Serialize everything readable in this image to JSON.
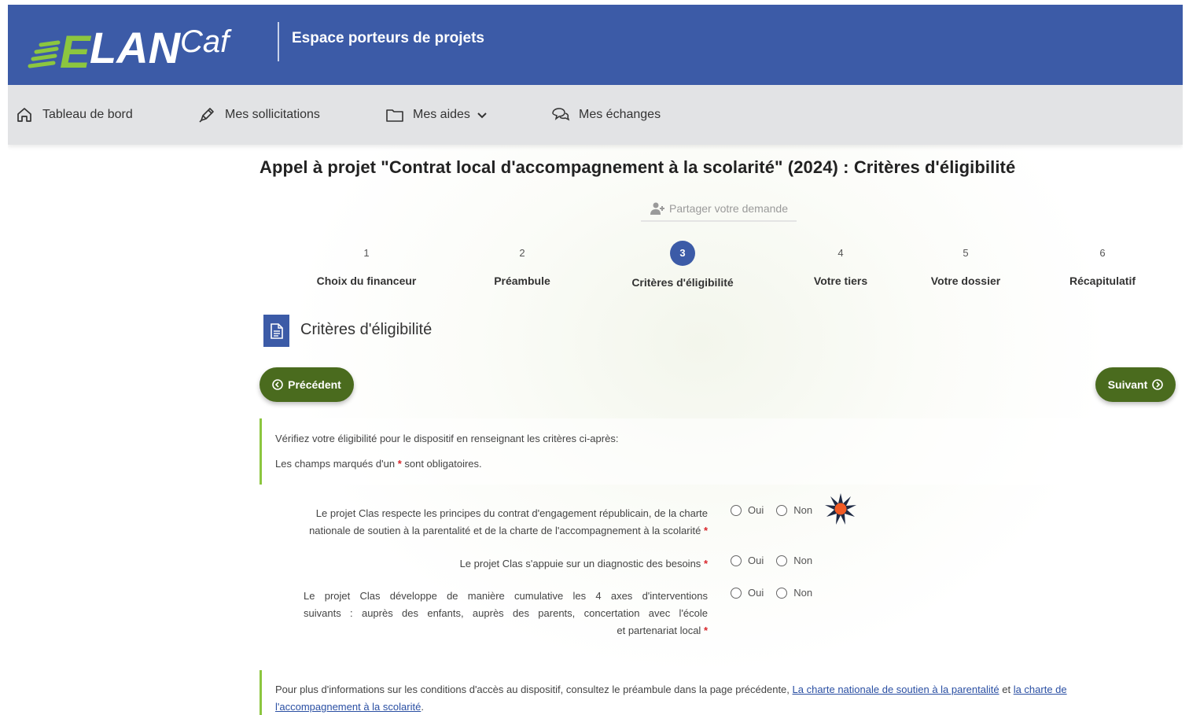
{
  "header": {
    "logo_main": "ELAN",
    "logo_sub": "Caf",
    "title": "Espace porteurs de projets",
    "colors": {
      "brand_blue": "#3c5ba7",
      "logo_green": "#8cc63f"
    }
  },
  "nav": {
    "items": [
      {
        "label": "Tableau de bord",
        "icon": "home-icon"
      },
      {
        "label": "Mes sollicitations",
        "icon": "pen-icon"
      },
      {
        "label": "Mes aides",
        "icon": "folder-icon",
        "has_dropdown": true
      },
      {
        "label": "Mes échanges",
        "icon": "chat-icon"
      }
    ]
  },
  "page": {
    "title": "Appel à projet \"Contrat local d'accompagnement à la scolarité\" (2024) : Critères d'éligibilité",
    "share_label": "Partager votre demande"
  },
  "steps": [
    {
      "num": "1",
      "label": "Choix du financeur"
    },
    {
      "num": "2",
      "label": "Préambule"
    },
    {
      "num": "3",
      "label": "Critères d'éligibilité",
      "active": true
    },
    {
      "num": "4",
      "label": "Votre tiers"
    },
    {
      "num": "5",
      "label": "Votre dossier"
    },
    {
      "num": "6",
      "label": "Récapitulatif"
    }
  ],
  "section": {
    "title": "Critères d'éligibilité",
    "prev_label": "Précédent",
    "next_label": "Suivant",
    "colors": {
      "button_green": "#4a6b1e",
      "required_red": "#d9262b"
    }
  },
  "info": {
    "line1": "Vérifiez votre éligibilité pour le dispositif en renseignant les critères ci-après:",
    "line2_pre": "Les champs marqués d'un ",
    "line2_star": "*",
    "line2_post": " sont obligatoires."
  },
  "questions": [
    {
      "lines": [
        "Le projet Clas respecte les principes du contrat d'engagement républicain, de la charte",
        "nationale de soutien à la parentalité et de la charte de l'accompagnement à la scolarité"
      ],
      "required": "*",
      "yes": "Oui",
      "no": "Non"
    },
    {
      "lines": [
        "Le projet Clas s'appuie sur un diagnostic des besoins"
      ],
      "required": "*",
      "yes": "Oui",
      "no": "Non"
    },
    {
      "lines": [
        "Le projet Clas développe de manière cumulative les 4 axes d'interventions",
        "suivants : auprès des enfants, auprès des parents, concertation avec l'école",
        "et partenariat local"
      ],
      "required": "*",
      "yes": "Oui",
      "no": "Non"
    }
  ],
  "footer": {
    "text_pre": "Pour plus d'informations sur les conditions d'accès au dispositif, consultez le préambule dans la page précédente, ",
    "link1": "La charte nationale de soutien à la parentalité",
    "text_mid": " et ",
    "link2": "la charte de l'accompagnement à la scolarité",
    "text_post": "."
  }
}
